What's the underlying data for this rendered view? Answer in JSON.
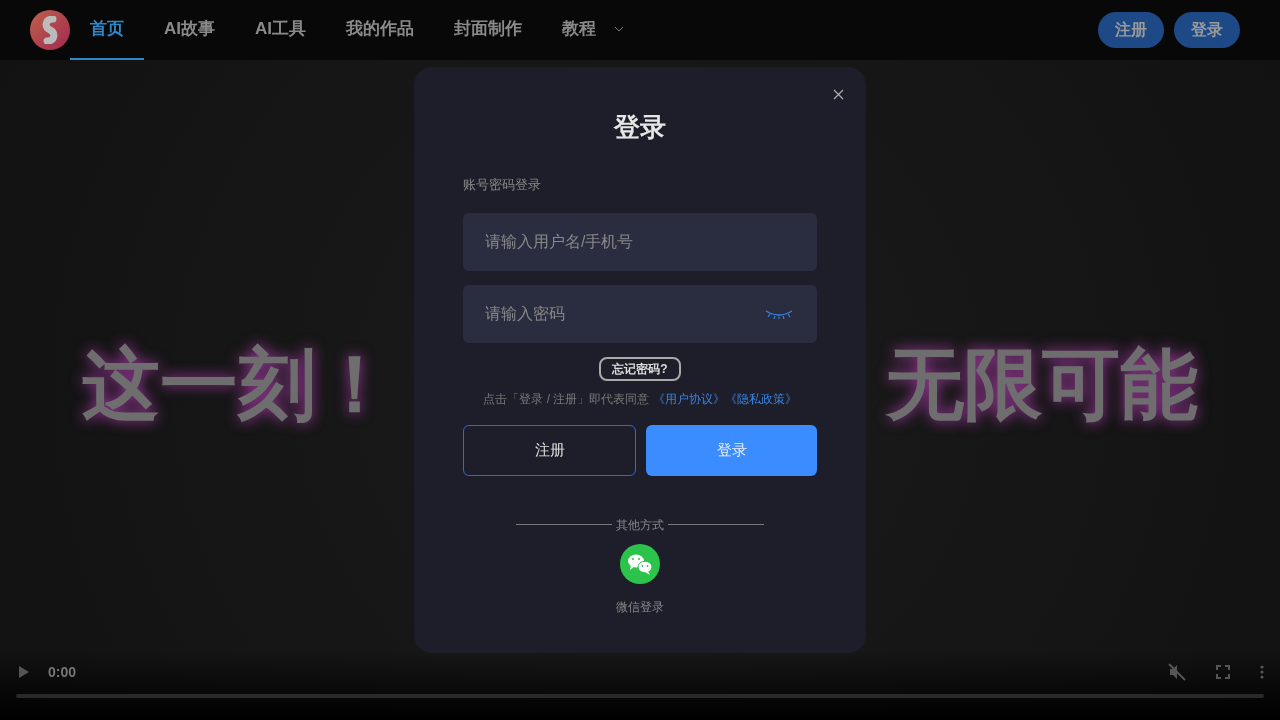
{
  "nav": {
    "items": [
      {
        "label": "首页",
        "selected": true,
        "kind": "link"
      },
      {
        "label": "AI故事",
        "selected": false,
        "kind": "link"
      },
      {
        "label": "AI工具",
        "selected": false,
        "kind": "link"
      },
      {
        "label": "我的作品",
        "selected": false,
        "kind": "link"
      },
      {
        "label": "封面制作",
        "selected": false,
        "kind": "link"
      },
      {
        "label": "教程",
        "selected": false,
        "kind": "dropdown"
      }
    ],
    "buttons": [
      "注册",
      "登录"
    ]
  },
  "hero": {
    "left": "这一刻！",
    "right": "无限可能"
  },
  "video": {
    "time": "0:00",
    "muted": true
  },
  "modal": {
    "title": "登录",
    "subtitle": "账号密码登录",
    "fields": [
      {
        "placeholder": "请输入用户名/手机号",
        "kind": "text"
      },
      {
        "placeholder": "请输入密码",
        "kind": "password"
      }
    ],
    "forgot": "忘记密码?",
    "agreement": {
      "text": "点击「登录 / 注册」即代表同意",
      "links": [
        "《用户协议》",
        "《隐私政策》"
      ]
    },
    "buttons": [
      {
        "label": "注册",
        "kind": "outline"
      },
      {
        "label": "登录",
        "kind": "primary"
      }
    ],
    "divider_label": "其他方式",
    "social": {
      "label": "微信登录"
    }
  }
}
